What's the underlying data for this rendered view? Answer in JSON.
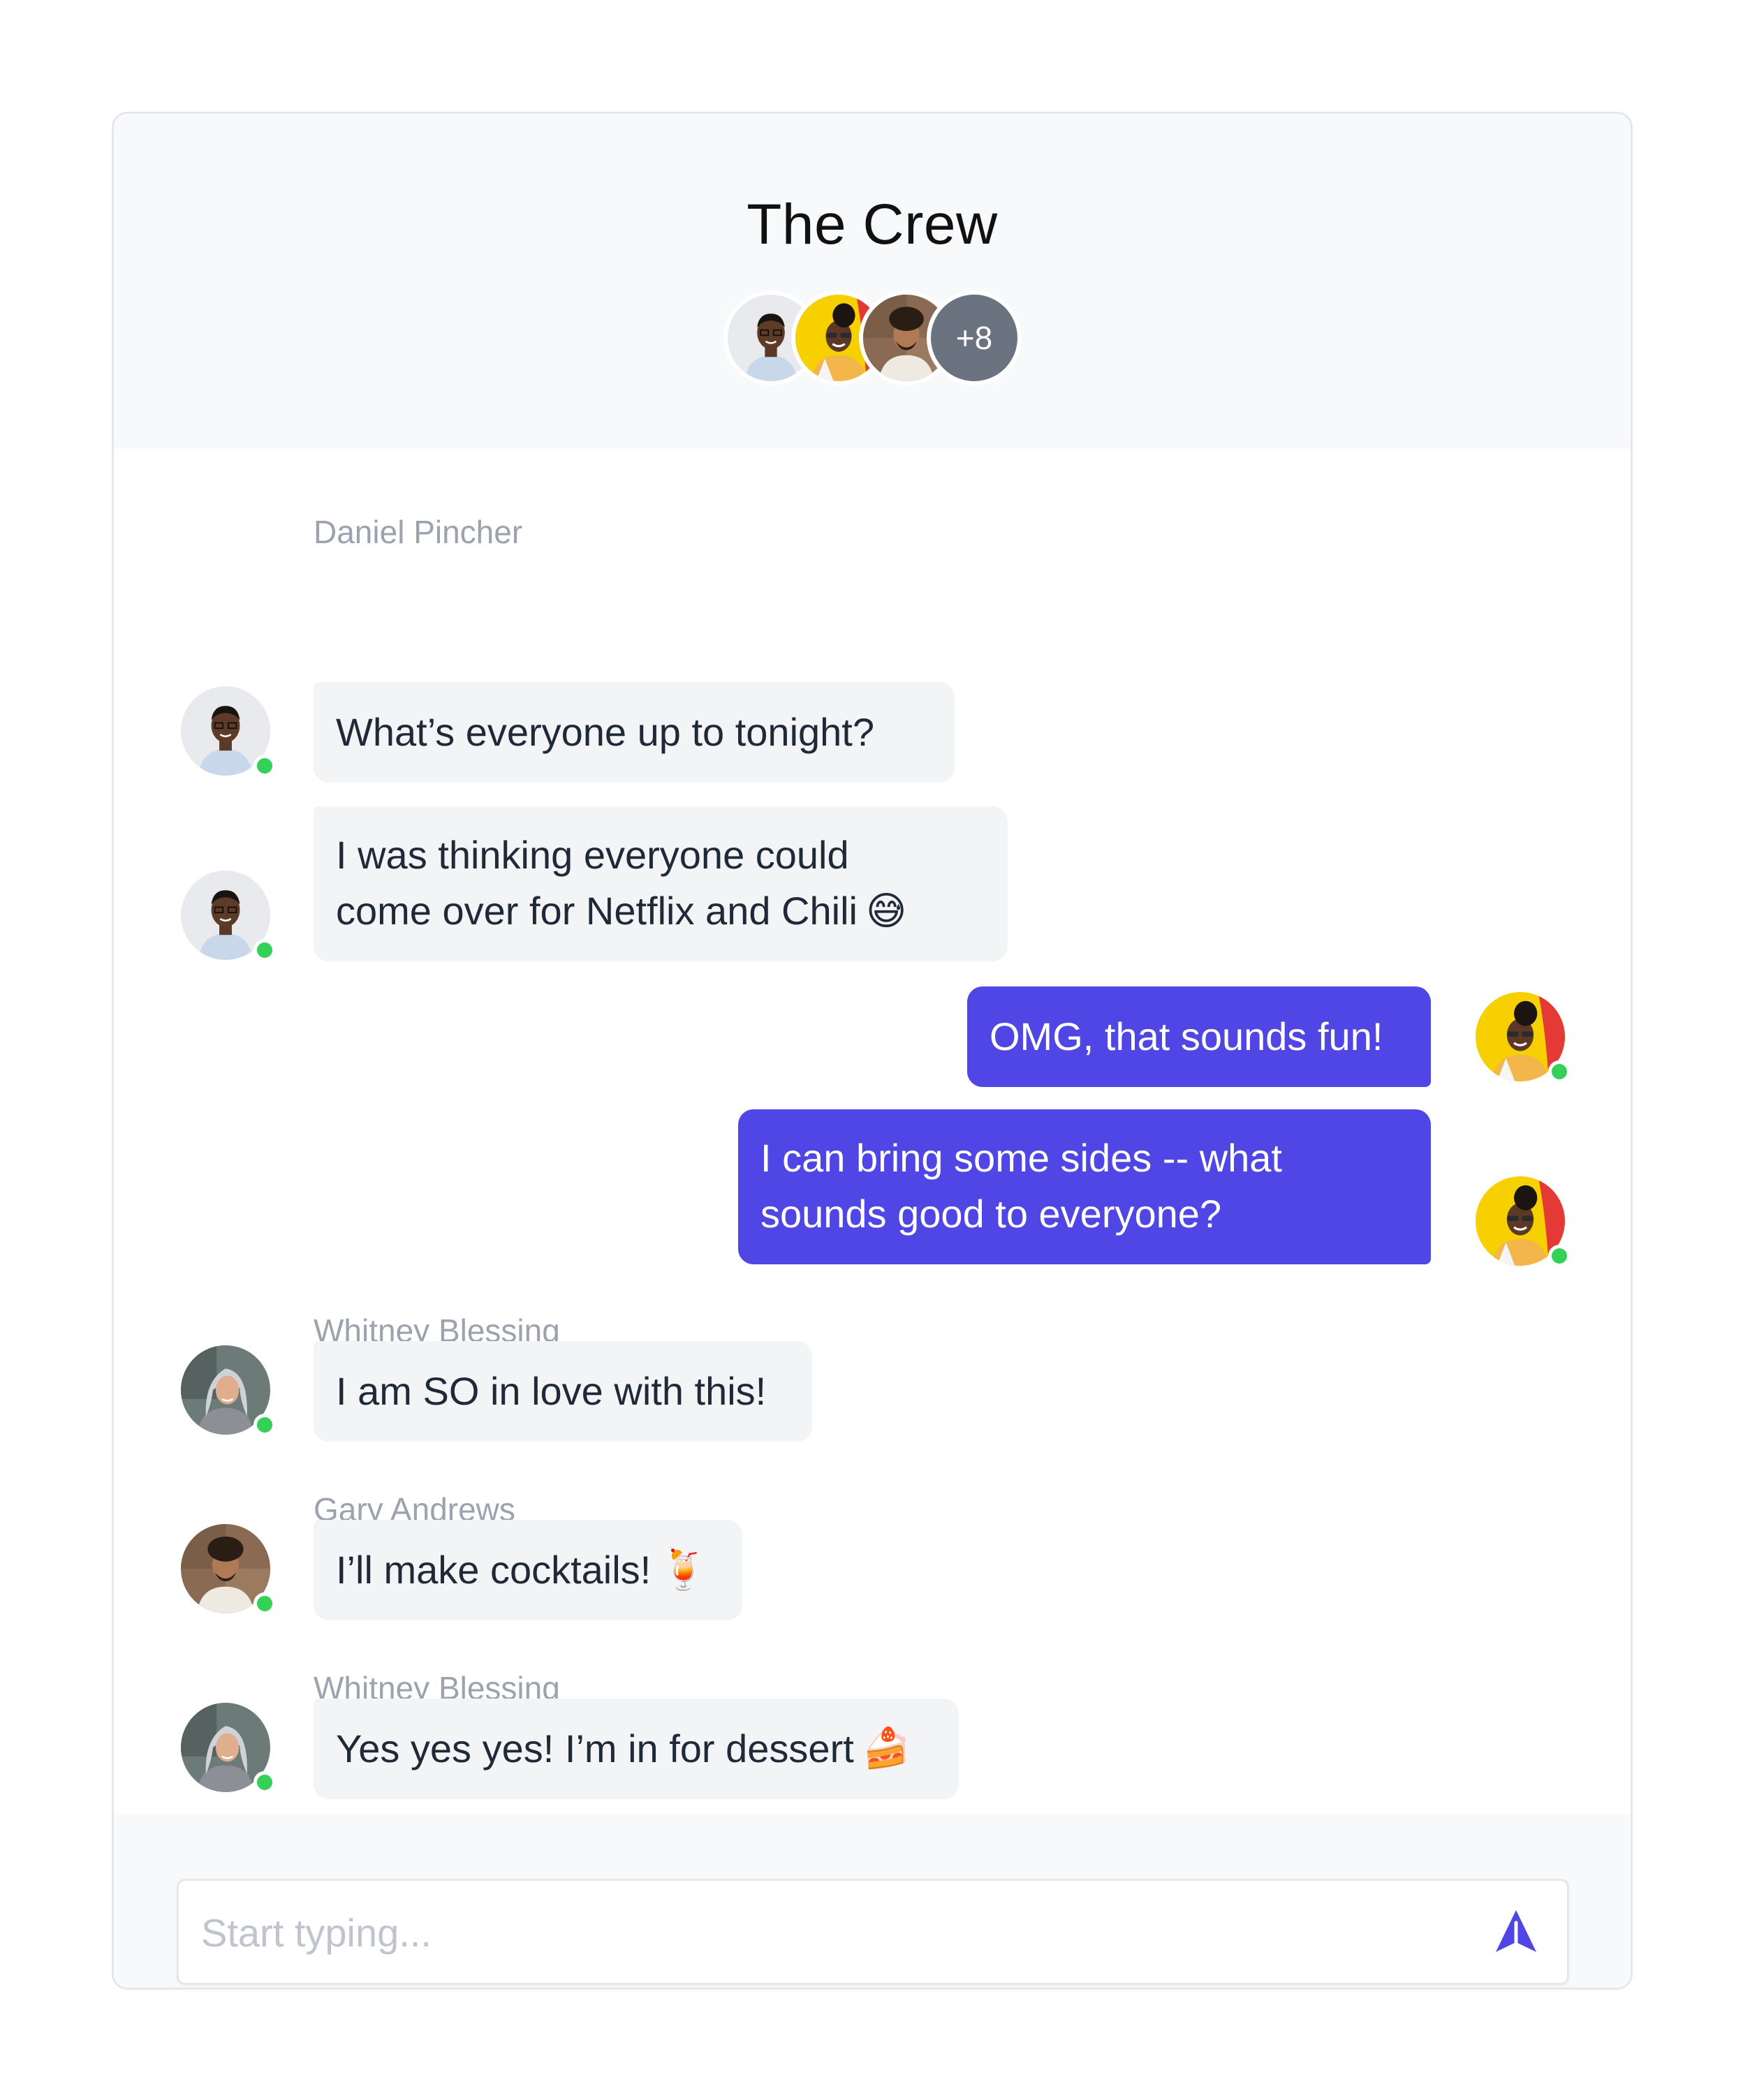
{
  "conversation": {
    "title": "The Crew",
    "participant_overflow": "+8"
  },
  "messages": [
    {
      "sender": "Daniel Pincher",
      "text": "What’s everyone up to tonight?",
      "emoji": ""
    },
    {
      "sender": "",
      "text_line1": "I was thinking everyone could",
      "text_line2": "come over for Netflix and Chili",
      "emoji": "😅"
    },
    {
      "sender": "",
      "text": "OMG, that sounds fun!",
      "emoji": ""
    },
    {
      "sender": "",
      "text_line1": "I can bring some sides -- what",
      "text_line2": "sounds good to everyone?",
      "emoji": ""
    },
    {
      "sender": "Whitney Blessing",
      "text": "I am SO in love with this!",
      "emoji": ""
    },
    {
      "sender": "Gary Andrews",
      "text": "I’ll make cocktails!",
      "emoji": "🍹"
    },
    {
      "sender": "Whitney Blessing",
      "text": "Yes yes yes! I’m in for dessert",
      "emoji": "🍰"
    }
  ],
  "composer": {
    "placeholder": "Start typing..."
  },
  "colors": {
    "accent": "#4f46e5",
    "online": "#34d058",
    "incoming_bubble": "#f3f4f6",
    "header_bg": "#f8f9fa"
  },
  "icons": {
    "send": "send-arrow-icon",
    "online": "online-status-dot"
  }
}
